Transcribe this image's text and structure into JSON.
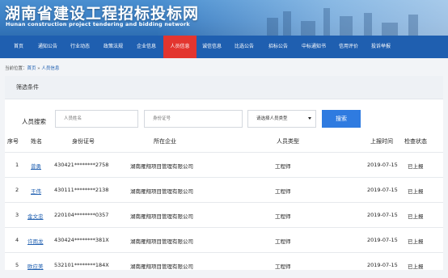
{
  "header": {
    "title_cn": "湖南省建设工程招标投标网",
    "title_en": "Hunan construction project tendering and bidding network"
  },
  "nav": {
    "items": [
      "首页",
      "通知公告",
      "行业动态",
      "政策法规",
      "企业信息",
      "人员信息",
      "诚信信息",
      "比选公告",
      "招标公告",
      "中标通知书",
      "信用评价",
      "投诉举报"
    ],
    "active_index": 5
  },
  "breadcrumb": {
    "prefix": "当前位置：",
    "home": "首页",
    "sep": " » ",
    "current": "人员信息"
  },
  "filter": {
    "heading": "筛选条件",
    "search_label": "人员搜索",
    "name_placeholder": "人员姓名",
    "id_placeholder": "身份证号",
    "company_placeholder": "",
    "type_selected": "请选择人员类型",
    "search_button": "搜索"
  },
  "table": {
    "headers": [
      "序号",
      "姓名",
      "身份证号",
      "所在企业",
      "人员类型",
      "上报时间",
      "检查状态"
    ],
    "rows": [
      {
        "no": "1",
        "name": "曾勇",
        "id": "430421********2758",
        "company": "湖南雁翔项目管理有限公司",
        "type": "工程师",
        "date": "2019-07-15",
        "status": "已上报"
      },
      {
        "no": "2",
        "name": "王伟",
        "id": "430111********2138",
        "company": "湖南雁翔项目管理有限公司",
        "type": "工程师",
        "date": "2019-07-15",
        "status": "已上报"
      },
      {
        "no": "3",
        "name": "金文忠",
        "id": "220104********0357",
        "company": "湖南雁翔项目管理有限公司",
        "type": "工程师",
        "date": "2019-07-15",
        "status": "已上报"
      },
      {
        "no": "4",
        "name": "许雨龙",
        "id": "430424********381X",
        "company": "湖南雁翔项目管理有限公司",
        "type": "工程师",
        "date": "2019-07-15",
        "status": "已上报"
      },
      {
        "no": "5",
        "name": "欧应美",
        "id": "532101********184X",
        "company": "湖南雁翔项目管理有限公司",
        "type": "工程师",
        "date": "2019-07-15",
        "status": "已上报"
      }
    ]
  },
  "colors": {
    "nav_bg": "#1f5fb0",
    "nav_active": "#e3352f",
    "button": "#2f7be0",
    "link": "#1f5fb0"
  }
}
